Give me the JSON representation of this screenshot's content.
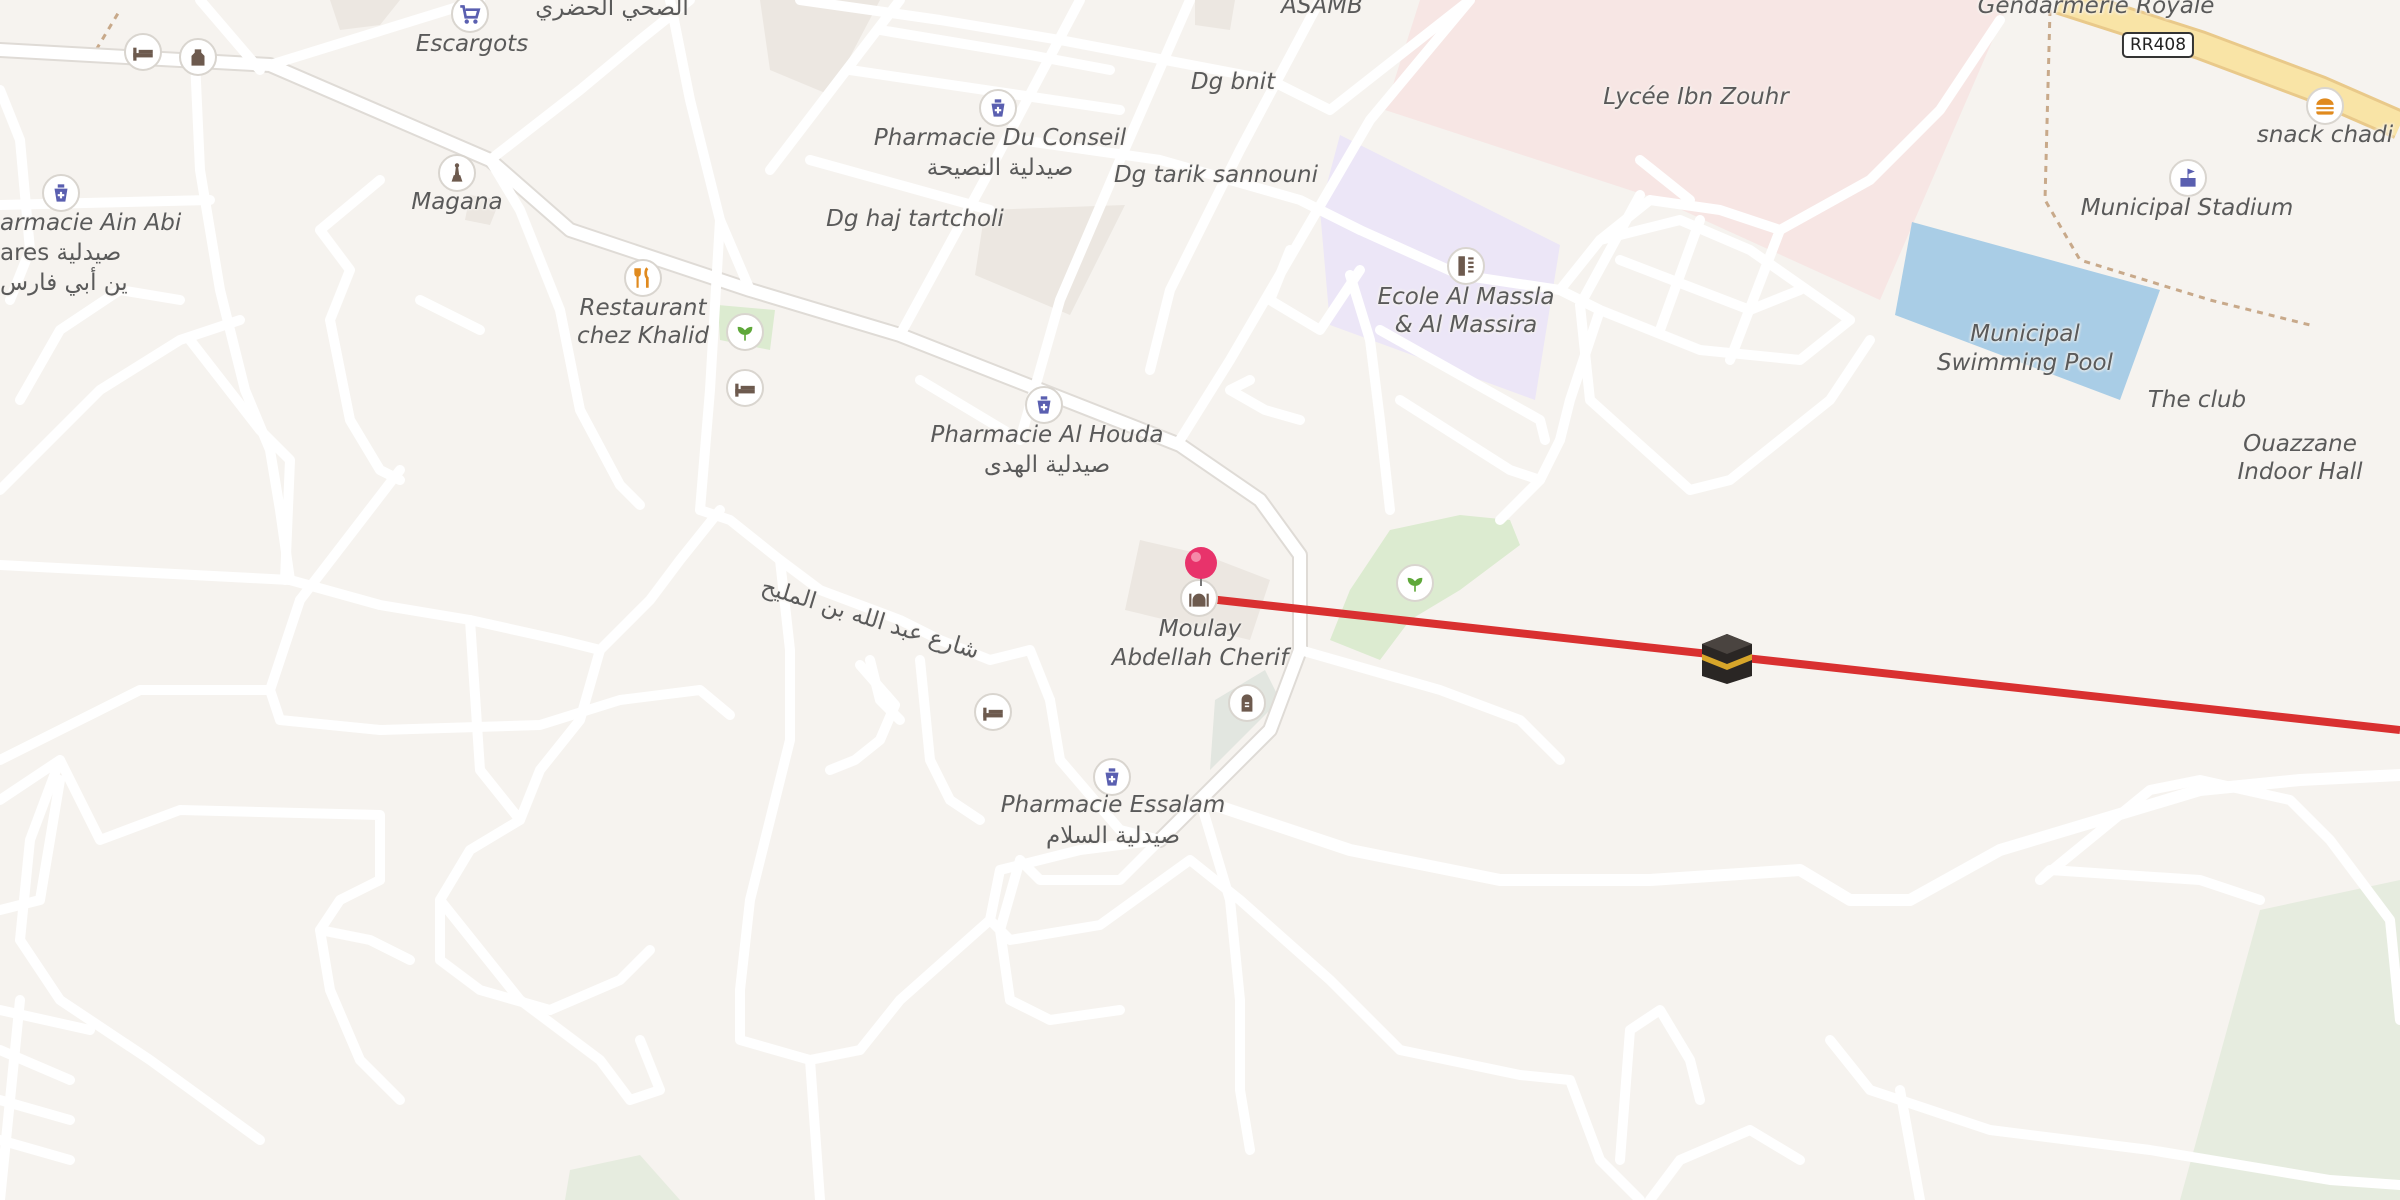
{
  "map": {
    "labels": {
      "escargots": "Escargots",
      "top_arabic": "الصحي الحضري",
      "asamb": "ASAMB",
      "gendarmerie": "Gendarmerie Royale",
      "dg_bnit": "Dg bnit",
      "lycee": "Lycée Ibn Zouhr",
      "pharmacie_conseil": "Pharmacie Du Conseil",
      "pharmacie_conseil_ar": "صيدلية النصيحة",
      "dg_tarik": "Dg tarik sannouni",
      "dg_haj": "Dg haj tartcholi",
      "magana": "Magana",
      "pharmacie_ain_line1": "armacie Ain Abi",
      "pharmacie_ain_line2": "ares صيدلية",
      "pharmacie_ain_line3": "ين أبي فارس",
      "restaurant_line1": "Restaurant",
      "restaurant_line2": "chez Khalid",
      "ecole_line1": "Ecole Al Massla",
      "ecole_line2": "& Al Massira",
      "pharmacie_houda": "Pharmacie Al Houda",
      "pharmacie_houda_ar": "صيدلية الهدى",
      "snack": "snack chadi",
      "stadium": "Municipal Stadium",
      "pool_line1": "Municipal",
      "pool_line2": "Swimming Pool",
      "the_club": "The club",
      "indoor_line1": "Ouazzane",
      "indoor_line2": "Indoor Hall",
      "street_ar": "شارع عبد الله بن المليح",
      "moulay_line1": "Moulay",
      "moulay_line2": "Abdellah Cherif",
      "pharmacie_essalam": "Pharmacie Essalam",
      "pharmacie_essalam_ar": "صيدلية السلام"
    },
    "route_shield": "RR408",
    "colors": {
      "background": "#f6f3ef",
      "qibla_line": "#d93030",
      "pin": "#e8336b",
      "school_area": "#f7e6e4",
      "education_area": "#ece6f7",
      "pool": "#a9cde6",
      "park": "#dcebd0",
      "pharmacy_icon": "#5a5fb0",
      "poi_icon": "#6d5a4e"
    },
    "icons": [
      "shopping-cart-icon",
      "pharmacy-icon",
      "hotel-icon",
      "monument-icon",
      "restaurant-icon",
      "garden-icon",
      "school-icon",
      "stadium-icon",
      "fast-food-icon",
      "cemetery-icon",
      "mosque-icon",
      "kaaba-icon",
      "location-pin-icon"
    ]
  }
}
